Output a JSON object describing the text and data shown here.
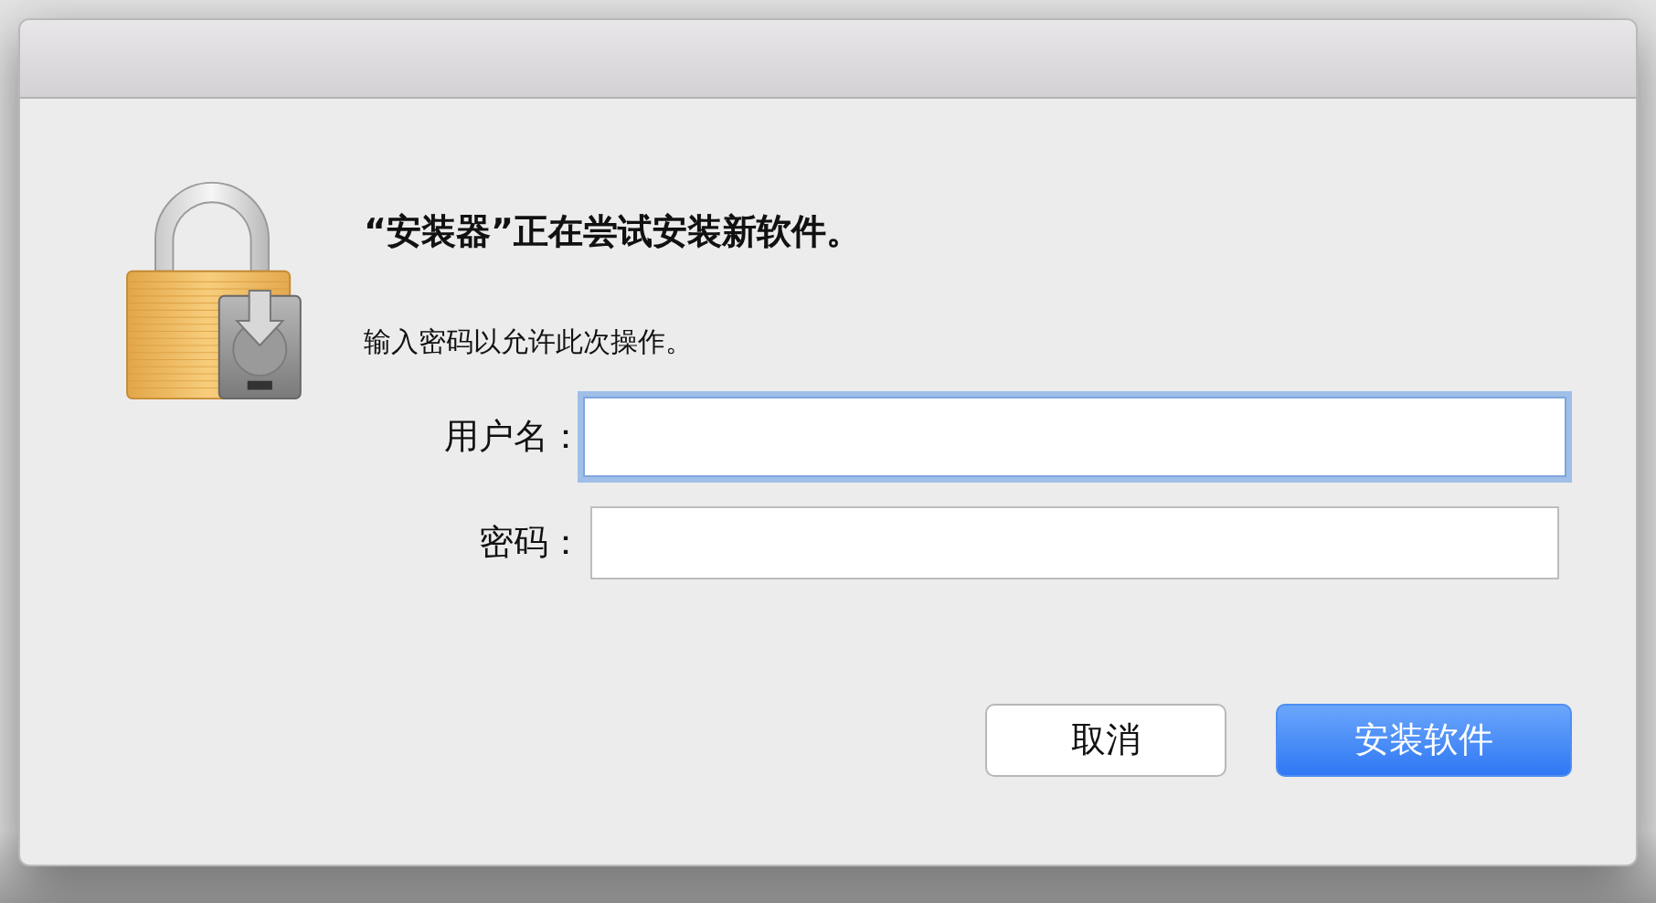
{
  "dialog": {
    "heading": "“安装器”正在尝试安装新软件。",
    "message": "输入密码以允许此次操作。",
    "fields": [
      {
        "label": "用户名：",
        "focused": true
      },
      {
        "label": "密码：",
        "focused": false
      }
    ],
    "buttons": [
      {
        "label": "取消",
        "kind": "secondary"
      },
      {
        "label": "安装软件",
        "kind": "primary"
      }
    ]
  }
}
